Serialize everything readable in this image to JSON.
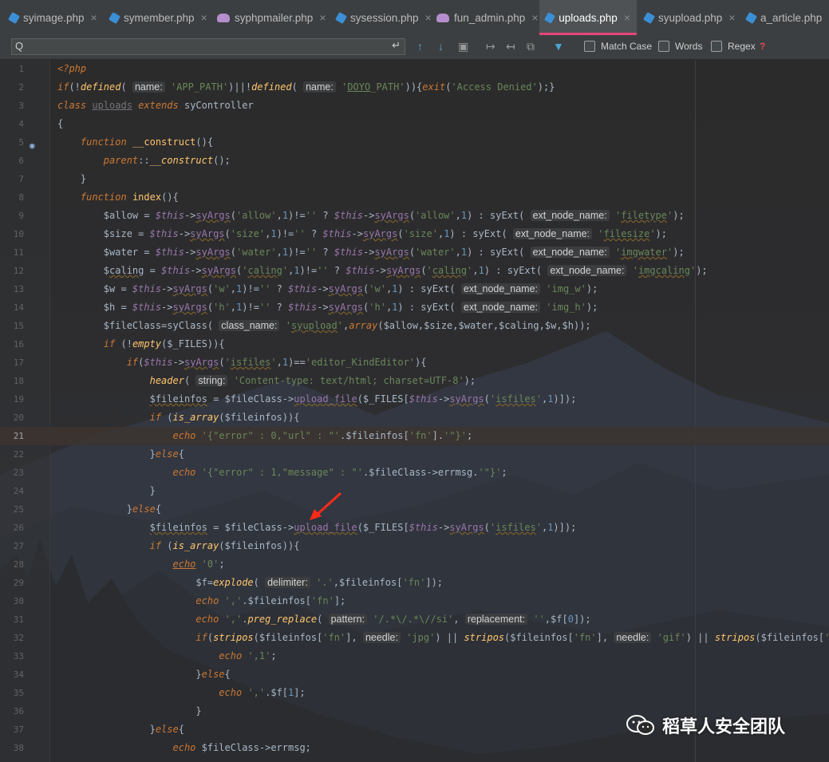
{
  "tabs": [
    {
      "label": "syimage.php",
      "icon": "php-file-icon"
    },
    {
      "label": "symember.php",
      "icon": "php-file-icon"
    },
    {
      "label": "syphpmailer.php",
      "icon": "elephant-php-icon"
    },
    {
      "label": "sysession.php",
      "icon": "php-file-icon"
    },
    {
      "label": "fun_admin.php",
      "icon": "elephant-php-icon"
    },
    {
      "label": "uploads.php",
      "icon": "php-file-icon",
      "active": true
    },
    {
      "label": "syupload.php",
      "icon": "php-file-icon"
    },
    {
      "label": "a_article.php",
      "icon": "php-file-icon"
    }
  ],
  "close_glyph": "×",
  "find": {
    "search_glyph": "Q",
    "enter_glyph": "↵",
    "value": "",
    "up": "↑",
    "down": "↓",
    "match_case": "Match Case",
    "words": "Words",
    "regex": "Regex",
    "help": "?"
  },
  "editor": {
    "highlight_line": 21,
    "lines": [
      {
        "n": "1"
      },
      {
        "n": "2"
      },
      {
        "n": "3"
      },
      {
        "n": "4"
      },
      {
        "n": "5"
      },
      {
        "n": "6"
      },
      {
        "n": "7"
      },
      {
        "n": "8"
      },
      {
        "n": "9"
      },
      {
        "n": "10"
      },
      {
        "n": "11"
      },
      {
        "n": "12"
      },
      {
        "n": "13"
      },
      {
        "n": "14"
      },
      {
        "n": "15"
      },
      {
        "n": "16"
      },
      {
        "n": "17"
      },
      {
        "n": "18"
      },
      {
        "n": "19"
      },
      {
        "n": "20"
      },
      {
        "n": "21"
      },
      {
        "n": "22"
      },
      {
        "n": "23"
      },
      {
        "n": "24"
      },
      {
        "n": "25"
      },
      {
        "n": "26"
      },
      {
        "n": "27"
      },
      {
        "n": "28"
      },
      {
        "n": "29"
      },
      {
        "n": "30"
      },
      {
        "n": "31"
      },
      {
        "n": "32"
      },
      {
        "n": "33"
      },
      {
        "n": "34"
      },
      {
        "n": "35"
      },
      {
        "n": "36"
      },
      {
        "n": "37"
      },
      {
        "n": "38"
      }
    ]
  },
  "watermark": "稻草人安全团队",
  "colors": {
    "accent": "#e8457a",
    "keyword": "#cc7832",
    "string": "#6a8759",
    "function": "#ffc66d",
    "variable": "#9876aa"
  }
}
